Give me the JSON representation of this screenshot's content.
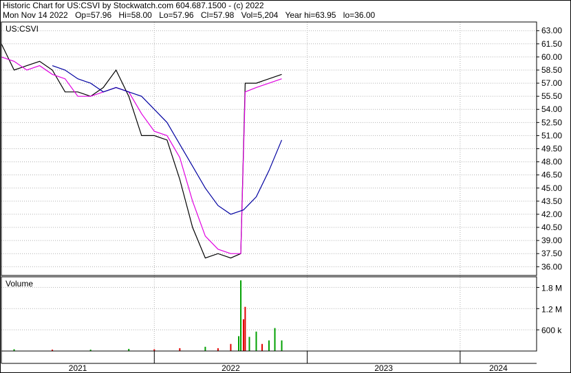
{
  "header": {
    "title_line": "Historic Chart for US:CSVI by Stockwatch.com 604.687.1500 - (c) 2022",
    "date": "Mon Nov 14 2022",
    "open": "Op=57.96",
    "high": "Hi=58.00",
    "low": "Lo=57.96",
    "close": "Cl=57.98",
    "volume": "Vol=5,204",
    "year_high": "Year hi=63.95",
    "year_low": "lo=36.00"
  },
  "colors": {
    "price": "#000000",
    "ma_short": "#e000e0",
    "ma_long": "#0000a0",
    "vol_up": "#00a000",
    "vol_down": "#e00000",
    "grid": "#b0b0b0"
  },
  "chart_data": [
    {
      "type": "line",
      "label": "US:CSVI",
      "x_range": [
        "2021-01",
        "2024-07"
      ],
      "ylim": [
        35.0,
        64.0
      ],
      "y_ticks": [
        "63.00",
        "61.50",
        "60.00",
        "58.50",
        "57.00",
        "55.50",
        "54.00",
        "52.50",
        "51.00",
        "49.50",
        "48.00",
        "46.50",
        "45.00",
        "43.50",
        "42.00",
        "40.50",
        "39.00",
        "37.50",
        "36.00"
      ],
      "grid": true,
      "series": [
        {
          "role": "price",
          "x": [
            "2021-01",
            "2021-02",
            "2021-03",
            "2021-04",
            "2021-05",
            "2021-06",
            "2021-07",
            "2021-08",
            "2021-09",
            "2021-10",
            "2021-11",
            "2021-12",
            "2022-01",
            "2022-02",
            "2022-03",
            "2022-04",
            "2022-05",
            "2022-06",
            "2022-07",
            "2022-07-25",
            "2022-08-05",
            "2022-09",
            "2022-10",
            "2022-11"
          ],
          "values": [
            61.5,
            58.5,
            59.0,
            59.5,
            58.5,
            56.0,
            56.0,
            55.5,
            56.5,
            58.5,
            55.5,
            51.0,
            51.0,
            50.5,
            46.0,
            40.5,
            37.0,
            37.5,
            37.0,
            37.5,
            57.0,
            57.0,
            57.5,
            58.0
          ]
        },
        {
          "role": "ma_short",
          "x": [
            "2021-01",
            "2021-02",
            "2021-03",
            "2021-04",
            "2021-05",
            "2021-06",
            "2021-07",
            "2021-08",
            "2021-09",
            "2021-10",
            "2021-11",
            "2021-12",
            "2022-01",
            "2022-02",
            "2022-03",
            "2022-04",
            "2022-05",
            "2022-06",
            "2022-07",
            "2022-07-25",
            "2022-08-05",
            "2022-09",
            "2022-10",
            "2022-11"
          ],
          "values": [
            60.0,
            59.5,
            58.5,
            59.0,
            58.0,
            57.5,
            55.5,
            55.5,
            56.0,
            56.5,
            56.0,
            53.5,
            51.5,
            51.0,
            48.5,
            43.5,
            39.5,
            38.0,
            37.5,
            37.5,
            56.0,
            56.5,
            57.0,
            57.5
          ]
        },
        {
          "role": "ma_long",
          "x": [
            "2021-05",
            "2021-06",
            "2021-07",
            "2021-08",
            "2021-09",
            "2021-10",
            "2021-11",
            "2021-12",
            "2022-01",
            "2022-02",
            "2022-03",
            "2022-04",
            "2022-05",
            "2022-06",
            "2022-07",
            "2022-08",
            "2022-09",
            "2022-10",
            "2022-11"
          ],
          "values": [
            59.0,
            58.5,
            57.5,
            57.0,
            56.0,
            56.5,
            56.0,
            55.5,
            54.0,
            52.5,
            50.0,
            47.5,
            45.0,
            43.0,
            42.0,
            42.5,
            44.0,
            47.0,
            50.5
          ]
        }
      ]
    },
    {
      "type": "bar",
      "label": "Volume",
      "ylim": [
        0,
        2100000
      ],
      "y_ticks": [
        "1.8 M",
        "1.2 M",
        "600 k"
      ],
      "y_tick_values": [
        1800000,
        1200000,
        600000
      ],
      "x_labels": [
        "2021",
        "2022",
        "2023",
        "2024"
      ],
      "x_dividers": [
        "2021-01",
        "2022-01",
        "2023-01",
        "2024-01"
      ],
      "grid": true,
      "x": [
        "2021-02",
        "2021-05",
        "2021-08",
        "2021-11",
        "2022-01",
        "2022-03",
        "2022-05",
        "2022-06",
        "2022-07",
        "2022-07-20",
        "2022-07-25",
        "2022-08-01",
        "2022-08-05",
        "2022-08-15",
        "2022-09",
        "2022-09-15",
        "2022-10",
        "2022-10-15",
        "2022-11"
      ],
      "values": [
        50000,
        40000,
        40000,
        60000,
        50000,
        80000,
        120000,
        80000,
        200000,
        420000,
        2000000,
        900000,
        1250000,
        400000,
        550000,
        200000,
        300000,
        650000,
        300000
      ],
      "up": [
        true,
        false,
        true,
        true,
        false,
        false,
        true,
        false,
        false,
        true,
        true,
        false,
        false,
        true,
        true,
        false,
        true,
        true,
        true
      ]
    }
  ]
}
